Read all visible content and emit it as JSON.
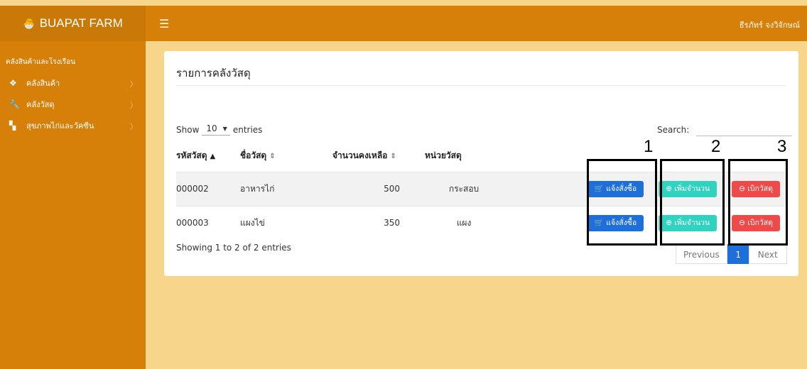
{
  "header": {
    "brand": "BUAPAT FARM",
    "user": "ธีรภัทร์ จงวิจักษณ์"
  },
  "sidebar": {
    "section_title": "คลังสินค้าและโรงเรือน",
    "items": [
      {
        "label": "คลังสินค้า",
        "icon": "cubes-icon"
      },
      {
        "label": "คลังวัสดุ",
        "icon": "wrench-icon"
      },
      {
        "label": "สุขภาพไก่และวัคซีน",
        "icon": "copy-icon"
      }
    ]
  },
  "card": {
    "title": "รายการคลังวัสดุ"
  },
  "length": {
    "prefix": "Show",
    "value": "10",
    "suffix": "entries"
  },
  "search": {
    "label": "Search:",
    "value": ""
  },
  "table": {
    "headers": [
      "รหัสวัสดุ",
      "ชื่อวัสดุ",
      "จำนวนคงเหลือ",
      "หน่วยวัสดุ"
    ],
    "rows": [
      {
        "code": "000002",
        "name": "อาหารไก่",
        "qty": "500",
        "unit": "กระสอบ"
      },
      {
        "code": "000003",
        "name": "แผงไข่",
        "qty": "350",
        "unit": "แผง"
      }
    ],
    "actions": {
      "order": "แจ้งสั่งซื้อ",
      "add": "เพิ่มจำนวน",
      "withdraw": "เบิกวัสดุ"
    }
  },
  "info": "Showing 1 to 2 of 2 entries",
  "pagination": {
    "previous": "Previous",
    "current": "1",
    "next": "Next"
  },
  "annotations": [
    "1",
    "2",
    "3"
  ]
}
